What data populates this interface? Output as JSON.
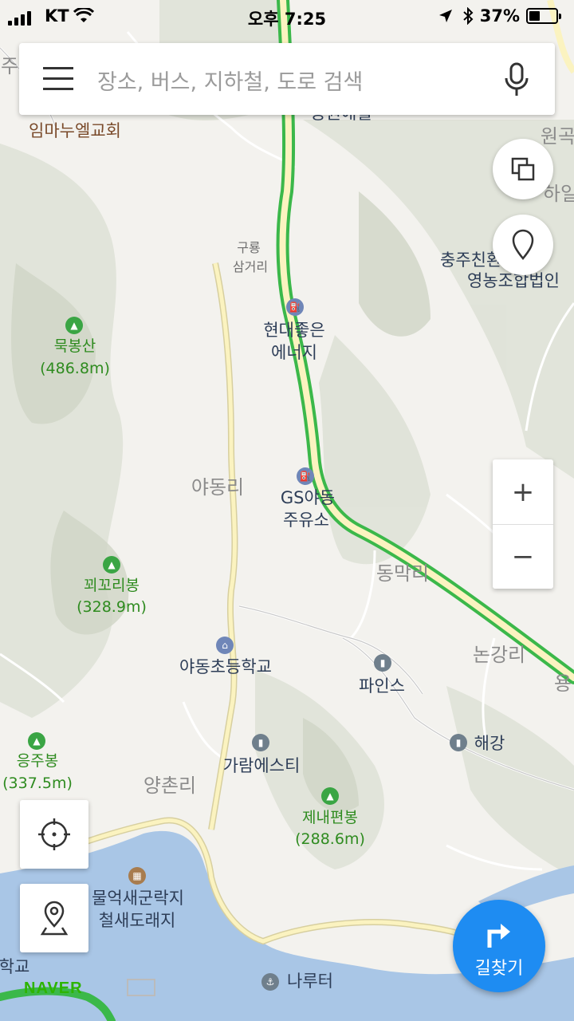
{
  "status": {
    "carrier": "KT",
    "time": "오후 7:25",
    "battery": "37%"
  },
  "search": {
    "placeholder": "장소, 버스, 지하철, 도로 검색"
  },
  "controls": {
    "zoom_in": "+",
    "zoom_out": "−",
    "directions": "길찾기"
  },
  "branding": {
    "logo": "NAVER"
  },
  "labels": {
    "ju": "주",
    "church": "임마누엘교회",
    "top_center": "중원애월",
    "wongok": "원곡",
    "hail": "하일",
    "gurong": "구룡",
    "samgeori": "삼거리",
    "chungju1": "충주친환경농",
    "chungju2": "영농조합법인",
    "hyundai1": "현대좋은",
    "hyundai2": "에너지",
    "mukbong": "묵봉산",
    "mukbong_h": "(486.8m)",
    "yadongri": "야동리",
    "gs1": "GS야동",
    "gs2": "주유소",
    "dongmakri": "동막리",
    "kkwoekkori": "꾀꼬리봉",
    "kkwoekkori_h": "(328.9m)",
    "school": "야동초등학교",
    "nonggangri": "논강리",
    "yong": "용",
    "pines": "파인스",
    "haegang": "해강",
    "eungju": "응주봉",
    "eungju_h": "(337.5m)",
    "garam": "가람에스티",
    "yangchonri": "양촌리",
    "jenae": "제내편봉",
    "jenae_h": "(288.6m)",
    "mulek1": "물억새군락지",
    "mulek2": "철새도래지",
    "hakgyo": "학교",
    "naruteo": "나루터"
  }
}
